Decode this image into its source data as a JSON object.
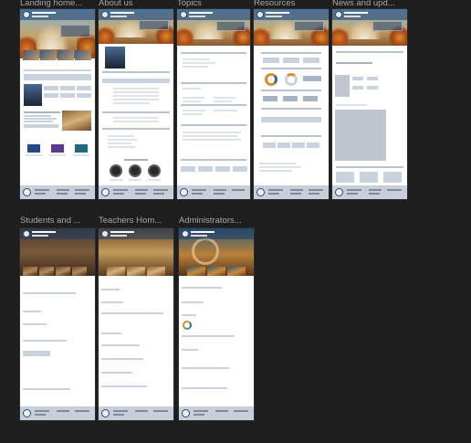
{
  "frames": [
    {
      "title": "Landing home..."
    },
    {
      "title": "About us"
    },
    {
      "title": "Topics"
    },
    {
      "title": "Resources"
    },
    {
      "title": "News and upd..."
    },
    {
      "title": "Students and ..."
    },
    {
      "title": "Teachers Hom..."
    },
    {
      "title": "Administrators..."
    }
  ],
  "colors": {
    "canvas": "#1e1e1e",
    "frame_title": "#a7a7a7",
    "placeholder": "#c9d3de",
    "accent_navy": "#234a86",
    "accent_purple": "#5a3a8a",
    "accent_teal": "#1e6b7e",
    "hero_autumn": "#d97a26"
  }
}
